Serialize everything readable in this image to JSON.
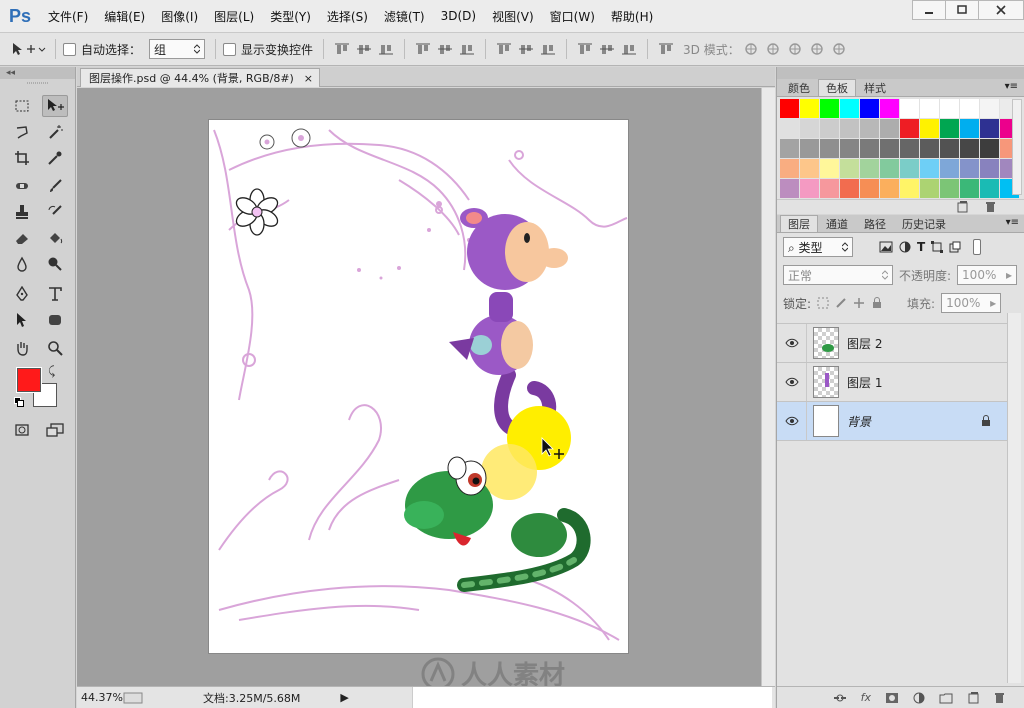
{
  "app": {
    "logo": "Ps"
  },
  "menu": [
    "文件(F)",
    "编辑(E)",
    "图像(I)",
    "图层(L)",
    "类型(Y)",
    "选择(S)",
    "滤镜(T)",
    "3D(D)",
    "视图(V)",
    "窗口(W)",
    "帮助(H)"
  ],
  "options": {
    "auto_select_label": "自动选择：",
    "auto_select_value": "组",
    "show_transform_label": "显示变换控件",
    "mode_3d_label": "3D 模式："
  },
  "document": {
    "tab_title": "图层操作.psd @ 44.4% (背景, RGB/8#)",
    "close": "×"
  },
  "status": {
    "zoom": "44.37%",
    "doc_size": "文档:3.25M/5.68M",
    "arrow": "▶"
  },
  "colors": {
    "foreground": "#ff1a1a",
    "background": "#ffffff"
  },
  "swatch_panel": {
    "tabs": [
      "颜色",
      "色板",
      "样式"
    ],
    "active_tab": "色板",
    "rows": [
      [
        "#ff0000",
        "#ffff00",
        "#00ff00",
        "#00ffff",
        "#0000ff",
        "#ff00ff",
        "#ffffff",
        "#ffffff",
        "#ffffff",
        "#ffffff",
        "#f4f4f4",
        "#ebebeb"
      ],
      [
        "#e0e0e0",
        "#d6d6d6",
        "#cccccc",
        "#c2c2c2",
        "#b8b8b8",
        "#adadad",
        "#ee1d24",
        "#fff200",
        "#00a651",
        "#00aeef",
        "#2e3192",
        "#ec008c"
      ],
      [
        "#a3a3a3",
        "#999999",
        "#8f8f8f",
        "#858585",
        "#7a7a7a",
        "#707070",
        "#666666",
        "#5c5c5c",
        "#525252",
        "#474747",
        "#3d3d3d",
        "#f7977a"
      ],
      [
        "#f9ad81",
        "#fdc68a",
        "#fff79a",
        "#c4df9b",
        "#a2d39c",
        "#82ca9d",
        "#7bcdc8",
        "#6ecff6",
        "#7ea7d8",
        "#8493ca",
        "#8882be",
        "#a187be"
      ],
      [
        "#bc8dbf",
        "#f49ac2",
        "#f6989d",
        "#f26c4f",
        "#f68e55",
        "#fbaf5d",
        "#fff467",
        "#acd372",
        "#7cc576",
        "#3bb878",
        "#1abbb4",
        "#00bff3"
      ]
    ]
  },
  "layers_panel": {
    "tabs": [
      "图层",
      "通道",
      "路径",
      "历史记录"
    ],
    "active_tab": "图层",
    "filter_kind": "类型",
    "blend_mode": "正常",
    "opacity_label": "不透明度:",
    "opacity_value": "100%",
    "lock_label": "锁定:",
    "fill_label": "填充:",
    "fill_value": "100%",
    "layers": [
      {
        "name": "图层 2",
        "selected": false,
        "locked": false
      },
      {
        "name": "图层 1",
        "selected": false,
        "locked": false
      },
      {
        "name": "背景",
        "selected": true,
        "locked": true
      }
    ],
    "footer_fx": "fx"
  },
  "watermark": {
    "text": "人人素材"
  }
}
